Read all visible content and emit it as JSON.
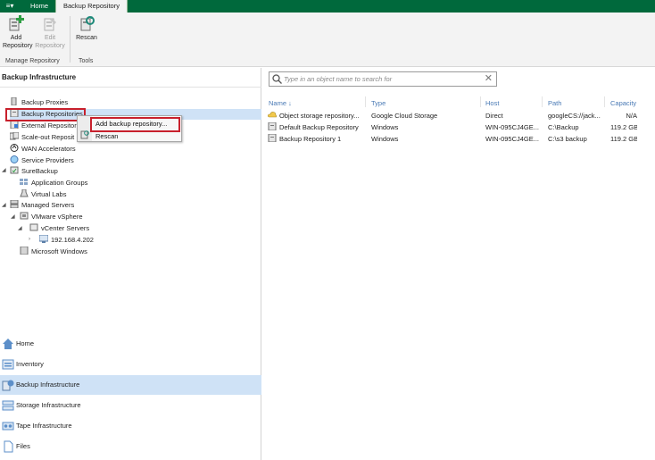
{
  "topbar": {
    "menu_glyph": "≡▾",
    "tabs": [
      {
        "label": "Home",
        "active": false
      },
      {
        "label": "Backup Repository",
        "active": true
      }
    ]
  },
  "ribbon": {
    "buttons": [
      {
        "label_line1": "Add",
        "label_line2": "Repository",
        "icon": "add-repository-icon",
        "enabled": true
      },
      {
        "label_line1": "Edit",
        "label_line2": "Repository",
        "icon": "edit-repository-icon",
        "enabled": false
      },
      {
        "label_line1": "Rescan",
        "label_line2": "",
        "icon": "rescan-icon",
        "enabled": true
      }
    ],
    "groups": [
      "Manage Repository",
      "Tools"
    ]
  },
  "left_panel": {
    "title": "Backup Infrastructure",
    "tree": [
      {
        "label": "Backup Proxies",
        "icon": "proxy-icon"
      },
      {
        "label": "Backup Repositories",
        "icon": "repository-icon",
        "selected": true
      },
      {
        "label": "External Repositor",
        "icon": "external-repository-icon"
      },
      {
        "label": "Scale-out Reposit",
        "icon": "scaleout-repository-icon"
      },
      {
        "label": "WAN Accelerators",
        "icon": "wan-accelerator-icon"
      },
      {
        "label": "Service Providers",
        "icon": "service-provider-icon"
      },
      {
        "label": "SureBackup",
        "icon": "surebackup-icon"
      },
      {
        "label": "Application Groups",
        "icon": "application-groups-icon"
      },
      {
        "label": "Virtual Labs",
        "icon": "virtual-labs-icon"
      },
      {
        "label": "Managed Servers",
        "icon": "managed-servers-icon"
      },
      {
        "label": "VMware vSphere",
        "icon": "vmware-icon"
      },
      {
        "label": "vCenter Servers",
        "icon": "vcenter-icon"
      },
      {
        "label": "192.168.4.202",
        "icon": "server-icon"
      },
      {
        "label": "Microsoft Windows",
        "icon": "windows-icon"
      }
    ],
    "context_menu": {
      "items": [
        "Add backup repository...",
        "Rescan"
      ]
    },
    "nav": [
      {
        "label": "Home",
        "icon": "home-icon"
      },
      {
        "label": "Inventory",
        "icon": "inventory-icon"
      },
      {
        "label": "Backup Infrastructure",
        "icon": "backup-infrastructure-icon",
        "selected": true
      },
      {
        "label": "Storage Infrastructure",
        "icon": "storage-infrastructure-icon"
      },
      {
        "label": "Tape Infrastructure",
        "icon": "tape-infrastructure-icon"
      },
      {
        "label": "Files",
        "icon": "files-icon"
      }
    ]
  },
  "main": {
    "search": {
      "placeholder": "Type in an object name to search for",
      "value": ""
    },
    "columns": [
      "Name ↓",
      "Type",
      "Host",
      "Path",
      "Capacity"
    ],
    "rows": [
      {
        "name": "Object storage repository...",
        "type": "Google Cloud Storage",
        "host": "Direct",
        "path": "googleCS://jack...",
        "capacity": "N/A",
        "icon": "cloud-repository-icon"
      },
      {
        "name": "Default Backup Repository",
        "type": "Windows",
        "host": "WIN-095CJ4GE...",
        "path": "C:\\Backup",
        "capacity": "119.2 GB",
        "icon": "repository-icon"
      },
      {
        "name": "Backup Repository 1",
        "type": "Windows",
        "host": "WIN-095CJ4GE...",
        "path": "C:\\s3 backup",
        "capacity": "119.2 GB",
        "icon": "repository-icon"
      }
    ]
  },
  "colors": {
    "topbar": "#00693c",
    "selection": "#cfe2f6",
    "highlight": "#c8202c",
    "header_text": "#4a7ab5"
  }
}
